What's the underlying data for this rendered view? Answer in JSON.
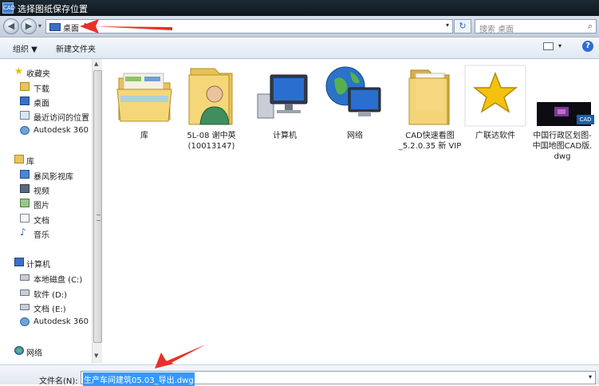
{
  "window": {
    "title": "选择图纸保存位置",
    "app_icon_text": "CAD"
  },
  "nav": {
    "back_glyph": "◀",
    "forward_glyph": "▶",
    "dropdown_glyph": "▾",
    "address": {
      "crumb": "桌面",
      "crumb_arrow": "▶",
      "dropdown": "▾"
    },
    "refresh_glyph": "↻",
    "search": {
      "placeholder": "搜索 桌面",
      "icon_glyph": "⌕"
    }
  },
  "toolbar": {
    "organize": "组织 ▼",
    "new_folder": "新建文件夹",
    "view_dropdown": "▾",
    "help_glyph": "?"
  },
  "sidebar": {
    "favorites": {
      "label": "收藏夹",
      "items": [
        "下载",
        "桌面",
        "最近访问的位置",
        "Autodesk 360"
      ]
    },
    "libraries": {
      "label": "库",
      "items": [
        "暴风影视库",
        "视频",
        "图片",
        "文档",
        "音乐"
      ]
    },
    "computer": {
      "label": "计算机",
      "items": [
        "本地磁盘 (C:)",
        "软件 (D:)",
        "文档 (E:)",
        "Autodesk 360"
      ]
    },
    "network": {
      "label": "网络"
    }
  },
  "content": {
    "items": [
      {
        "label": "库",
        "icon": "library-folder-icon"
      },
      {
        "label": "5L-08  谢中英\n(10013147)",
        "icon": "user-folder-icon"
      },
      {
        "label": "计算机",
        "icon": "computer-icon"
      },
      {
        "label": "网络",
        "icon": "network-icon"
      },
      {
        "label": "CAD快速看图\n_5.2.0.35 新 VIP",
        "icon": "folder-icon"
      },
      {
        "label": "广联达软件",
        "icon": "star-shortcut-icon"
      },
      {
        "label": "中国行政区划图-\n中国地图CAD版.\ndwg",
        "icon": "dwg-thumbnail-icon"
      }
    ],
    "dwg_badge": "CAD"
  },
  "scrollbar": {
    "up_glyph": "▲",
    "down_glyph": "▼"
  },
  "filename": {
    "label": "文件名(N):",
    "value": "生产车间建筑05.03_导出.dwg",
    "dropdown": "▾"
  },
  "colors": {
    "annotation_arrow": "#e8302a",
    "selection": "#3399ff"
  }
}
